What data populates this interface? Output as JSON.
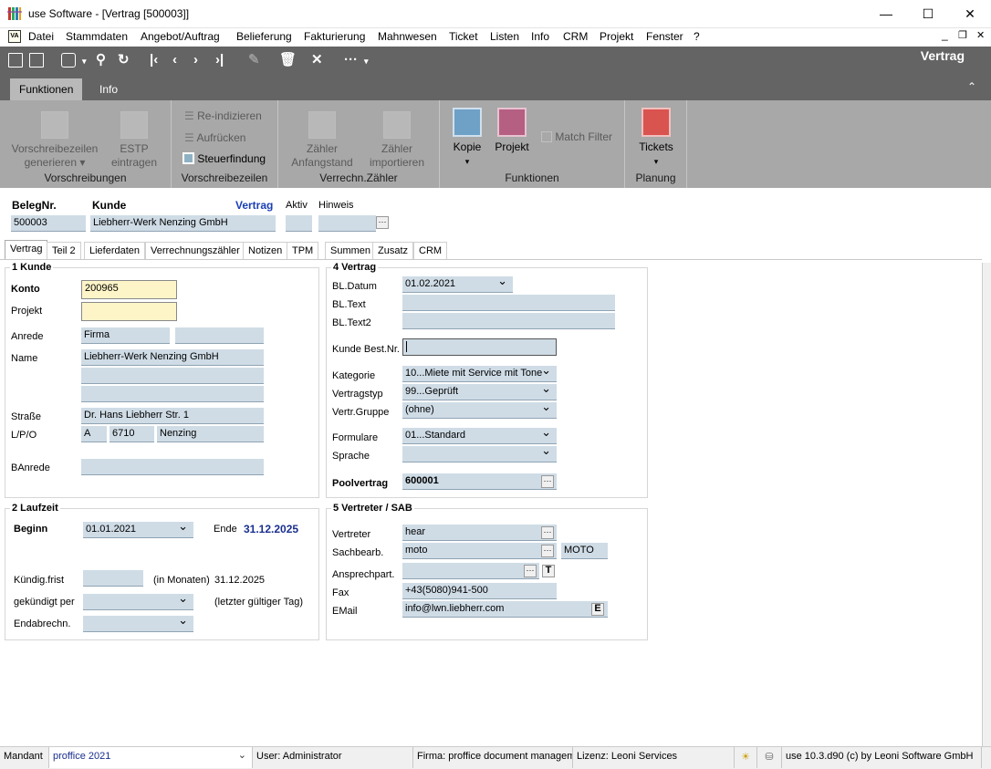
{
  "window": {
    "title": "use Software - [Vertrag [500003]]",
    "minimize": "—",
    "maximize": "☐",
    "close": "✕"
  },
  "menu": [
    "Datei",
    "Stammdaten",
    "Angebot/Auftrag",
    "Belieferung",
    "Fakturierung",
    "Mahnwesen",
    "Ticket",
    "Listen",
    "Info",
    "CRM",
    "Projekt",
    "Fenster",
    "?"
  ],
  "mdi": {
    "min": "_",
    "restore": "❐",
    "close": "✕"
  },
  "ribbon": {
    "context_title": "Vertrag",
    "tabs": [
      "Funktionen",
      "Info"
    ],
    "groups": {
      "vorschreibungen": {
        "label": "Vorschreibungen",
        "btn1": "Vorschreibezeilen\ngenerieren ▾",
        "btn2": "ESTP\neintragen"
      },
      "vorschreibezeilen": {
        "label": "Vorschreibezeilen",
        "items": [
          "Re-indizieren",
          "Aufrücken",
          "Steuerfindung"
        ]
      },
      "zaehler": {
        "label": "Verrechn.Zähler",
        "btn1": "Zähler\nAnfangstand",
        "btn2": "Zähler\nimportieren"
      },
      "funktionen": {
        "label": "Funktionen",
        "kopie": "Kopie",
        "projekt": "Projekt",
        "match": "Match Filter"
      },
      "planung": {
        "label": "Planung",
        "tickets": "Tickets"
      }
    }
  },
  "header": {
    "beleg_label": "BelegNr.",
    "beleg": "500003",
    "kunde_label": "Kunde",
    "kunde": "Liebherr-Werk Nenzing GmbH",
    "vertrag_label": "Vertrag",
    "aktiv_label": "Aktiv",
    "hinweis_label": "Hinweis",
    "dots": "···"
  },
  "tabs": [
    "Vertrag",
    "Teil 2",
    "Lieferdaten",
    "Verrechnungszähler",
    "Notizen",
    "TPM",
    "Summen",
    "Zusatz",
    "CRM"
  ],
  "kunde": {
    "title": "1 Kunde",
    "konto_label": "Konto",
    "konto": "200965",
    "projekt_label": "Projekt",
    "anrede_label": "Anrede",
    "anrede": "Firma",
    "name_label": "Name",
    "name": "Liebherr-Werk Nenzing GmbH",
    "strasse_label": "Straße",
    "strasse": "Dr. Hans Liebherr Str. 1",
    "lpo_label": "L/P/O",
    "land": "A",
    "plz": "6710",
    "ort": "Nenzing",
    "banrede_label": "BAnrede"
  },
  "laufzeit": {
    "title": "2 Laufzeit",
    "beginn_label": "Beginn",
    "beginn": "01.01.2021",
    "ende_label": "Ende",
    "ende": "31.12.2025",
    "kuend_label": "Kündig.frist",
    "monaten": "(in Monaten)",
    "kuend_date": "31.12.2025",
    "gek_label": "gekündigt per",
    "letzter": "(letzter gültiger Tag)",
    "endab_label": "Endabrechn."
  },
  "vertrag": {
    "title": "4 Vertrag",
    "bldatum_label": "BL.Datum",
    "bldatum": "01.02.2021",
    "bltext_label": "BL.Text",
    "bltext2_label": "BL.Text2",
    "bestnr_label": "Kunde Best.Nr.",
    "kat_label": "Kategorie",
    "kat": "10...Miete mit Service mit Toner",
    "typ_label": "Vertragstyp",
    "typ": "99...Geprüft",
    "gruppe_label": "Vertr.Gruppe",
    "gruppe": "(ohne)",
    "form_label": "Formulare",
    "form": "01...Standard",
    "sprache_label": "Sprache",
    "pool_label": "Poolvertrag",
    "pool": "600001"
  },
  "vertreter": {
    "title": "5 Vertreter / SAB",
    "vertreter_label": "Vertreter",
    "vertreter": "hear",
    "sach_label": "Sachbearb.",
    "sach": "moto",
    "sach_code": "MOTO",
    "ansp_label": "Ansprechpart.",
    "t_btn": "T",
    "fax_label": "Fax",
    "fax": "+43(5080)941-500",
    "email_label": "EMail",
    "email": "info@lwn.liebherr.com",
    "e_btn": "E"
  },
  "status": {
    "mandant_label": "Mandant",
    "mandant": "proffice 2021",
    "user": "User: Administrator",
    "firma": "Firma: proffice document manageme",
    "lizenz": "Lizenz: Leoni Services",
    "version": "use 10.3.d90 (c) by Leoni Software GmbH"
  }
}
